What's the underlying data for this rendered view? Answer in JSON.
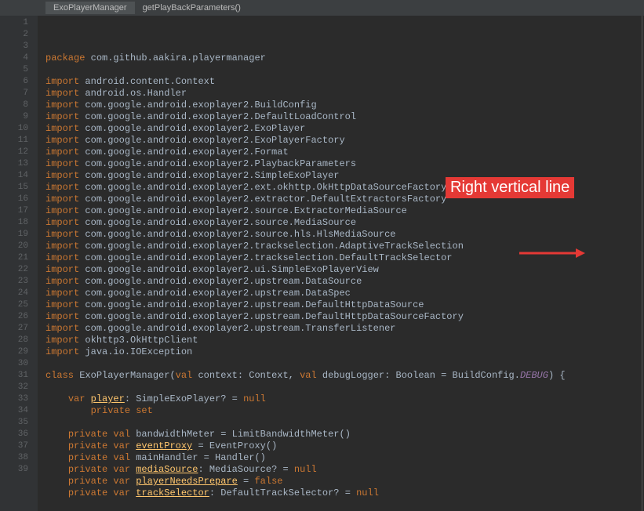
{
  "breadcrumb": {
    "class": "ExoPlayerManager",
    "method": "getPlayBackParameters()"
  },
  "annotation": {
    "label": "Right vertical line"
  },
  "code": {
    "lines": [
      {
        "n": 1,
        "k": "package",
        "rest": " com.github.aakira.playermanager"
      },
      {
        "n": 2,
        "k": "",
        "rest": ""
      },
      {
        "n": 3,
        "k": "import",
        "rest": " android.content.Context"
      },
      {
        "n": 4,
        "k": "import",
        "rest": " android.os.Handler"
      },
      {
        "n": 5,
        "k": "import",
        "rest": " com.google.android.exoplayer2.BuildConfig"
      },
      {
        "n": 6,
        "k": "import",
        "rest": " com.google.android.exoplayer2.DefaultLoadControl"
      },
      {
        "n": 7,
        "k": "import",
        "rest": " com.google.android.exoplayer2.ExoPlayer"
      },
      {
        "n": 8,
        "k": "import",
        "rest": " com.google.android.exoplayer2.ExoPlayerFactory"
      },
      {
        "n": 9,
        "k": "import",
        "rest": " com.google.android.exoplayer2.Format"
      },
      {
        "n": 10,
        "k": "import",
        "rest": " com.google.android.exoplayer2.PlaybackParameters"
      },
      {
        "n": 11,
        "k": "import",
        "rest": " com.google.android.exoplayer2.SimpleExoPlayer"
      },
      {
        "n": 12,
        "k": "import",
        "rest": " com.google.android.exoplayer2.ext.okhttp.OkHttpDataSourceFactory"
      },
      {
        "n": 13,
        "k": "import",
        "rest": " com.google.android.exoplayer2.extractor.DefaultExtractorsFactory"
      },
      {
        "n": 14,
        "k": "import",
        "rest": " com.google.android.exoplayer2.source.ExtractorMediaSource"
      },
      {
        "n": 15,
        "k": "import",
        "rest": " com.google.android.exoplayer2.source.MediaSource"
      },
      {
        "n": 16,
        "k": "import",
        "rest": " com.google.android.exoplayer2.source.hls.HlsMediaSource"
      },
      {
        "n": 17,
        "k": "import",
        "rest": " com.google.android.exoplayer2.trackselection.AdaptiveTrackSelection"
      },
      {
        "n": 18,
        "k": "import",
        "rest": " com.google.android.exoplayer2.trackselection.DefaultTrackSelector"
      },
      {
        "n": 19,
        "k": "import",
        "rest": " com.google.android.exoplayer2.ui.SimpleExoPlayerView"
      },
      {
        "n": 20,
        "k": "import",
        "rest": " com.google.android.exoplayer2.upstream.DataSource"
      },
      {
        "n": 21,
        "k": "import",
        "rest": " com.google.android.exoplayer2.upstream.DataSpec"
      },
      {
        "n": 22,
        "k": "import",
        "rest": " com.google.android.exoplayer2.upstream.DefaultHttpDataSource"
      },
      {
        "n": 23,
        "k": "import",
        "rest": " com.google.android.exoplayer2.upstream.DefaultHttpDataSourceFactory"
      },
      {
        "n": 24,
        "k": "import",
        "rest": " com.google.android.exoplayer2.upstream.TransferListener"
      },
      {
        "n": 25,
        "k": "import",
        "rest": " okhttp3.OkHttpClient"
      },
      {
        "n": 26,
        "k": "import",
        "rest": " java.io.IOException"
      },
      {
        "n": 27,
        "k": "",
        "rest": ""
      }
    ],
    "classLine": {
      "n": 28,
      "k1": "class ",
      "name": "ExoPlayerManager(",
      "k2": "val ",
      "p1": "context",
      "t1": ": Context, ",
      "k3": "val ",
      "p2": "debugLogger",
      "t2": ": Boolean = BuildConfig.",
      "it": "DEBUG",
      "end": ") {"
    },
    "body": [
      {
        "n": 29,
        "indent": "",
        "html": ""
      },
      {
        "n": 30,
        "indent": "    ",
        "html": "<span class='k'>var </span><span class='id'>player</span>: SimpleExoPlayer? = <span class='k'>null</span>"
      },
      {
        "n": 31,
        "indent": "        ",
        "html": "<span class='k'>private set</span>"
      },
      {
        "n": 32,
        "indent": "",
        "html": ""
      },
      {
        "n": 33,
        "indent": "    ",
        "html": "<span class='k'>private val </span><span class='s'>bandwidthMeter</span> = LimitBandwidthMeter()"
      },
      {
        "n": 34,
        "indent": "    ",
        "html": "<span class='k'>private var </span><span class='id'>eventProxy</span> = EventProxy()"
      },
      {
        "n": 35,
        "indent": "    ",
        "html": "<span class='k'>private val </span><span class='s'>mainHandler</span> = Handler()"
      },
      {
        "n": 36,
        "indent": "    ",
        "html": "<span class='k'>private var </span><span class='id'>mediaSource</span>: MediaSource? = <span class='k'>null</span>"
      },
      {
        "n": 37,
        "indent": "    ",
        "html": "<span class='k'>private var </span><span class='id'>playerNeedsPrepare</span> = <span class='k'>false</span>"
      },
      {
        "n": 38,
        "indent": "    ",
        "html": "<span class='k'>private var </span><span class='id'>trackSelector</span>: DefaultTrackSelector? = <span class='k'>null</span>"
      },
      {
        "n": 39,
        "indent": "",
        "html": ""
      }
    ]
  }
}
